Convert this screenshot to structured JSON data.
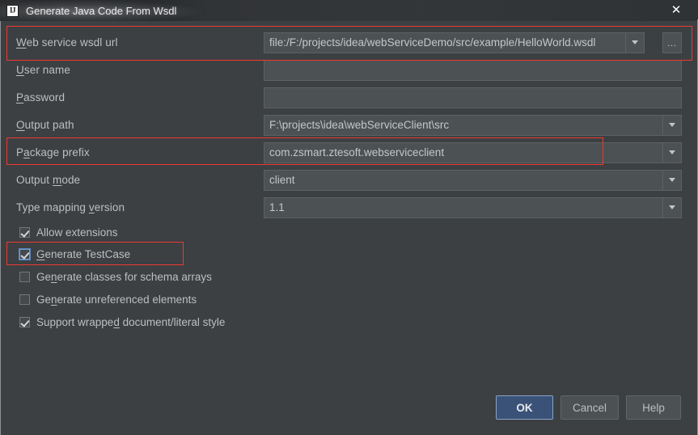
{
  "window": {
    "title": "Generate Java Code From Wsdl",
    "app_icon": "IJ",
    "close_icon": "✕"
  },
  "form": {
    "rows": [
      {
        "id": "wsdl-url",
        "label_pre": "W",
        "label_post": "eb service wsdl url",
        "value": "file:/F:/projects/idea/webServiceDemo/src/example/HelloWorld.wsdl",
        "control": "combo-with-browse",
        "browse_label": "…"
      },
      {
        "id": "user-name",
        "label_pre": "U",
        "label_post": "ser name",
        "value": "",
        "control": "text"
      },
      {
        "id": "password",
        "label_pre": "P",
        "label_post": "assword",
        "value": "",
        "control": "text"
      },
      {
        "id": "output-path",
        "label_pre": "O",
        "label_post": "utput path",
        "value": "F:\\projects\\idea\\webServiceClient\\src",
        "control": "combo"
      },
      {
        "id": "package-prefix",
        "label_pre": "P",
        "label_mid": "a",
        "label_post": "ckage prefix",
        "value": "com.zsmart.ztesoft.webserviceclient",
        "control": "combo-split"
      },
      {
        "id": "output-mode",
        "label_pre": "Output ",
        "label_mid": "m",
        "label_post": "ode",
        "value": "client",
        "control": "combo"
      },
      {
        "id": "type-mapping-version",
        "label_pre": "Type mapping ",
        "label_mid": "v",
        "label_post": "ersion",
        "value": "1.1",
        "control": "combo"
      }
    ],
    "checkboxes": [
      {
        "id": "allow-extensions",
        "pre": "Allow extensions",
        "mnemonic": "",
        "post": "",
        "checked": true,
        "focused": false
      },
      {
        "id": "generate-testcase",
        "pre": "",
        "mnemonic": "G",
        "post": "enerate TestCase",
        "checked": true,
        "focused": true
      },
      {
        "id": "generate-classes-schema-arrays",
        "pre": "Ge",
        "mnemonic": "n",
        "post": "erate classes for schema arrays",
        "checked": false,
        "focused": false
      },
      {
        "id": "generate-unreferenced-elements",
        "pre": "Ge",
        "mnemonic": "n",
        "post": "erate unreferenced elements",
        "checked": false,
        "focused": false
      },
      {
        "id": "support-wrapped-doc-literal",
        "pre": "Support wrappe",
        "mnemonic": "d",
        "post": " document/literal style",
        "checked": true,
        "focused": false
      }
    ]
  },
  "buttons": {
    "ok": "OK",
    "cancel": "Cancel",
    "help": "Help"
  },
  "annotations": {
    "highlight_color": "#f0382e",
    "boxes": [
      {
        "name": "wsdl-url-row-highlight"
      },
      {
        "name": "package-prefix-row-highlight"
      },
      {
        "name": "generate-testcase-highlight"
      }
    ]
  }
}
